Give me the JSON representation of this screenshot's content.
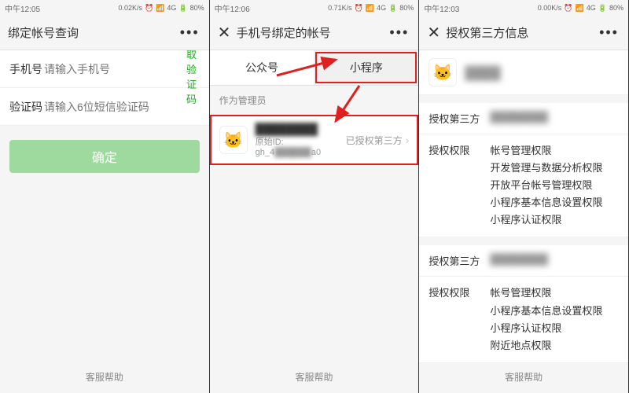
{
  "screen1": {
    "status": {
      "time": "中午12:05",
      "net": "0.02K/s",
      "sig": "4G",
      "bat": "80%"
    },
    "title": "绑定帐号查询",
    "more": "•••",
    "close": "✕",
    "phone_label": "手机号",
    "phone_placeholder": "请输入手机号",
    "get_code": "获取验证码",
    "code_label": "验证码",
    "code_placeholder": "请输入6位短信验证码",
    "confirm": "确定",
    "footer": "客服帮助"
  },
  "screen2": {
    "status": {
      "time": "中午12:06",
      "net": "0.71K/s",
      "sig": "4G",
      "bat": "80%"
    },
    "title": "手机号绑定的帐号",
    "more": "•••",
    "close": "✕",
    "tabs": {
      "a": "公众号",
      "b": "小程序"
    },
    "section": "作为管理员",
    "app": {
      "name": "████████",
      "sub_prefix": "原始ID: gh_4",
      "sub_suffix": "a0",
      "status": "已授权第三方"
    },
    "footer": "客服帮助"
  },
  "screen3": {
    "status": {
      "time": "中午12:03",
      "net": "0.00K/s",
      "sig": "4G",
      "bat": "80%"
    },
    "title": "授权第三方信息",
    "more": "•••",
    "close": "✕",
    "row_app": "████",
    "group1": {
      "party_label": "授权第三方",
      "party_value": "████████",
      "perm_label": "授权权限",
      "perms": [
        "帐号管理权限",
        "开发管理与数据分析权限",
        "开放平台帐号管理权限",
        "小程序基本信息设置权限",
        "小程序认证权限"
      ]
    },
    "group2": {
      "party_label": "授权第三方",
      "party_value": "████████",
      "perm_label": "授权权限",
      "perms": [
        "帐号管理权限",
        "小程序基本信息设置权限",
        "小程序认证权限",
        "附近地点权限"
      ]
    },
    "footer": "客服帮助"
  }
}
